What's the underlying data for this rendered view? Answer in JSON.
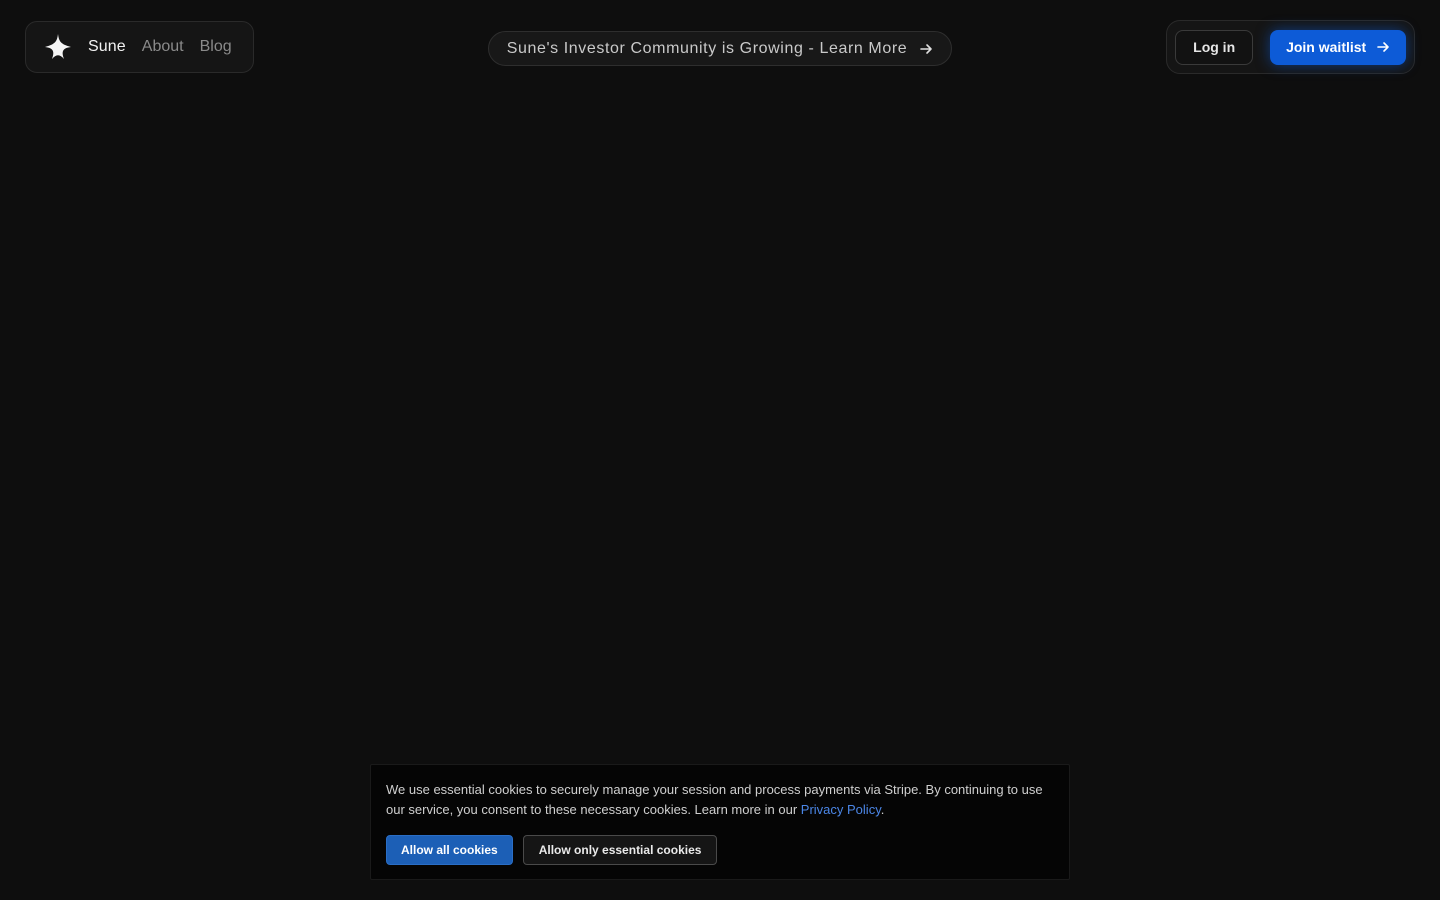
{
  "nav": {
    "brand": "Sune",
    "links": [
      {
        "label": "About"
      },
      {
        "label": "Blog"
      }
    ]
  },
  "announcement": {
    "text": "Sune's Investor Community is Growing - Learn More"
  },
  "auth": {
    "login_label": "Log in",
    "join_label": "Join waitlist"
  },
  "cookie_banner": {
    "message": "We use essential cookies to securely manage your session and process payments via Stripe. By continuing to use our service, you consent to these necessary cookies. Learn more in our ",
    "link_text": "Privacy Policy",
    "trailing": ".",
    "allow_all_label": "Allow all cookies",
    "essential_label": "Allow only essential cookies"
  },
  "icons": {
    "logo": "sparkle-star-icon",
    "announce_arrow": "arrow-right-icon",
    "join_arrow": "arrow-right-icon"
  },
  "colors": {
    "background": "#0e0e0e",
    "accent": "#0d5bd7",
    "link": "#4b86e6"
  }
}
